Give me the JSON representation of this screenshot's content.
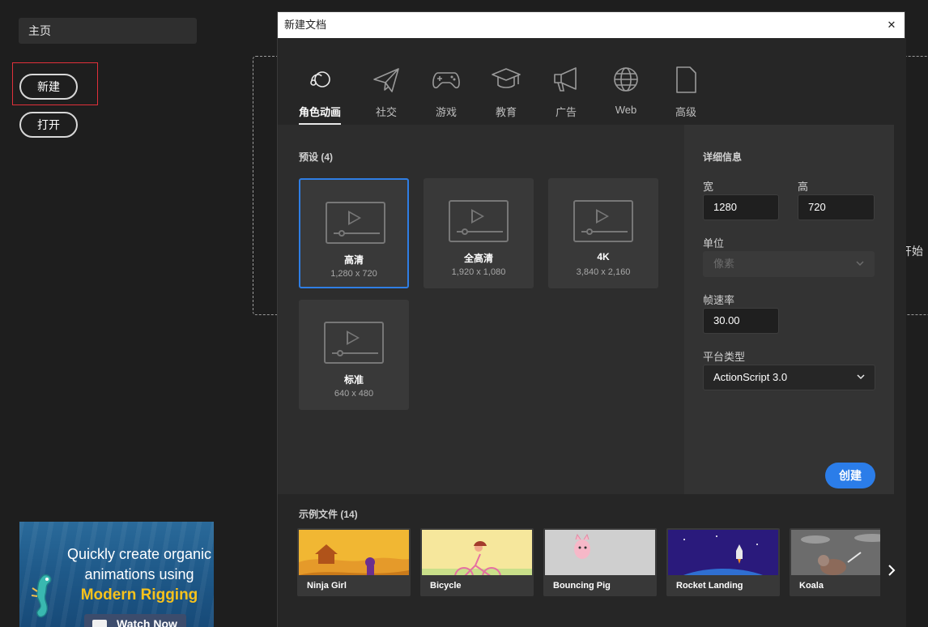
{
  "home": {
    "tab_label": "主页",
    "new_button": "新建",
    "open_button": "打开",
    "drop_text": "开始"
  },
  "promo": {
    "line1": "Quickly create organic",
    "line2": "animations using",
    "line3": "Modern Rigging",
    "watch_label": "Watch Now"
  },
  "dialog": {
    "title": "新建文档",
    "close_glyph": "✕",
    "tabs": [
      {
        "label": "角色动画",
        "icon": "character-animation-icon",
        "active": true
      },
      {
        "label": "社交",
        "icon": "paper-plane-icon",
        "active": false
      },
      {
        "label": "游戏",
        "icon": "gamepad-icon",
        "active": false
      },
      {
        "label": "教育",
        "icon": "graduation-cap-icon",
        "active": false
      },
      {
        "label": "广告",
        "icon": "megaphone-icon",
        "active": false
      },
      {
        "label": "Web",
        "icon": "globe-icon",
        "active": false
      },
      {
        "label": "高级",
        "icon": "document-icon",
        "active": false
      }
    ],
    "presets_heading": "预设 (4)",
    "presets": [
      {
        "name": "高清",
        "size": "1,280 x 720",
        "selected": true
      },
      {
        "name": "全高清",
        "size": "1,920 x 1,080",
        "selected": false
      },
      {
        "name": "4K",
        "size": "3,840 x 2,160",
        "selected": false
      },
      {
        "name": "标准",
        "size": "640 x 480",
        "selected": false
      }
    ],
    "details": {
      "heading": "详细信息",
      "width_label": "宽",
      "width_value": "1280",
      "height_label": "高",
      "height_value": "720",
      "units_label": "单位",
      "units_value": "像素",
      "framerate_label": "帧速率",
      "framerate_value": "30.00",
      "platform_label": "平台类型",
      "platform_value": "ActionScript 3.0",
      "create_button": "创建"
    },
    "samples_heading": "示例文件 (14)",
    "samples": [
      {
        "name": "Ninja Girl"
      },
      {
        "name": "Bicycle"
      },
      {
        "name": "Bouncing Pig"
      },
      {
        "name": "Rocket Landing"
      },
      {
        "name": "Koala"
      }
    ],
    "colors": {
      "accent": "#2b7de9",
      "selected_border": "#2f7ee4",
      "highlight_box": "#e0303a"
    }
  }
}
